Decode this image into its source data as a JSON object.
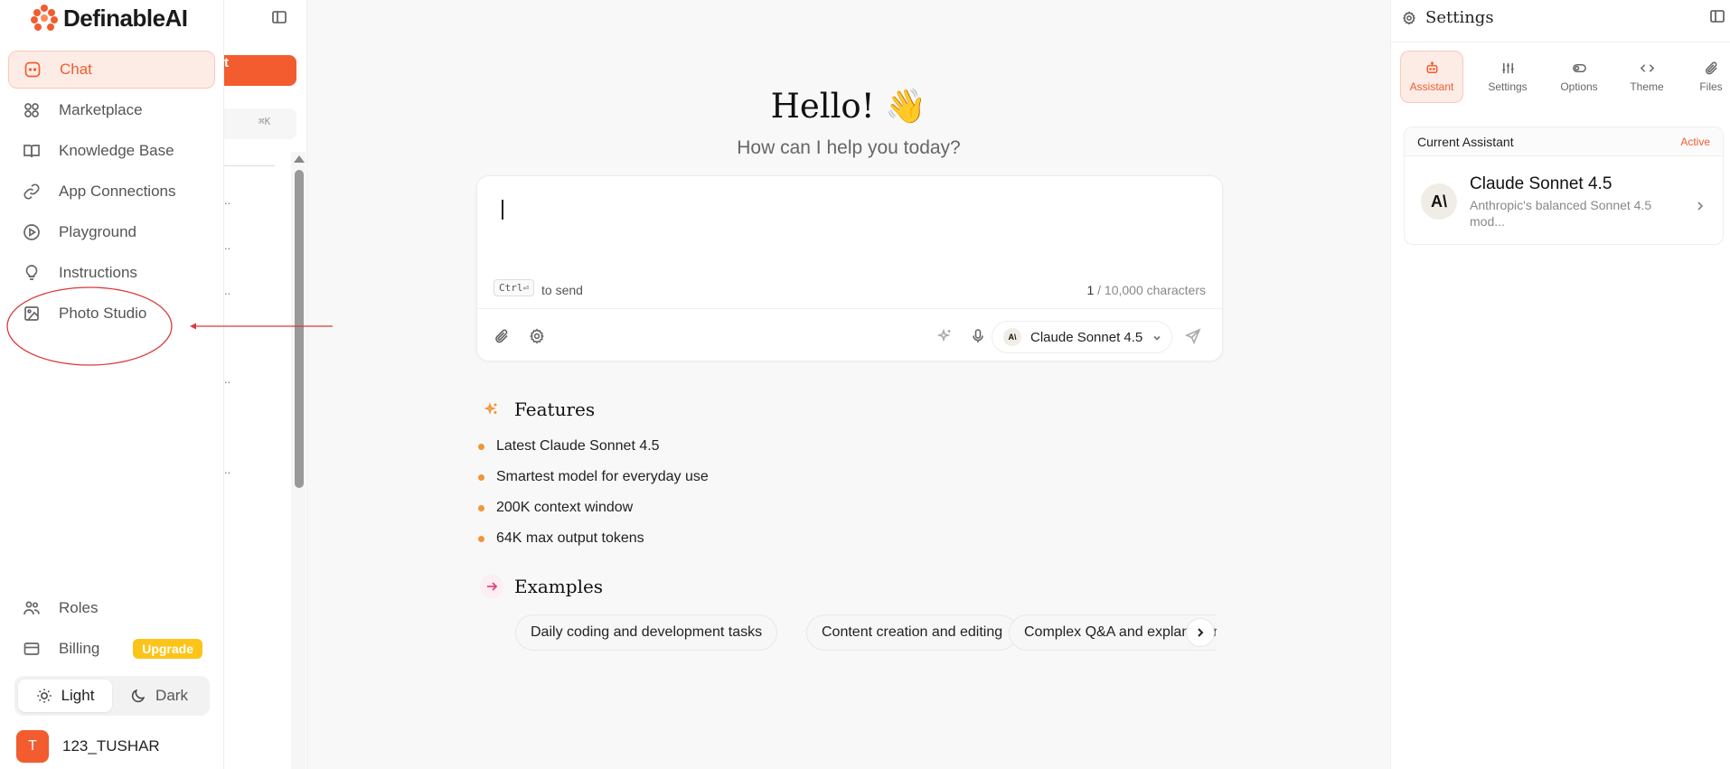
{
  "brand": {
    "name": "DefinableAI",
    "accent": "#f25c2f"
  },
  "nav": {
    "items": [
      {
        "label": "Chat",
        "icon": "chat-icon",
        "active": true
      },
      {
        "label": "Marketplace",
        "icon": "grid-icon"
      },
      {
        "label": "Knowledge Base",
        "icon": "book-icon"
      },
      {
        "label": "App Connections",
        "icon": "link-icon"
      },
      {
        "label": "Playground",
        "icon": "play-icon"
      },
      {
        "label": "Instructions",
        "icon": "lightbulb-icon"
      },
      {
        "label": "Photo Studio",
        "icon": "image-icon"
      }
    ],
    "bottom": [
      {
        "label": "Roles",
        "icon": "users-icon"
      },
      {
        "label": "Billing",
        "icon": "card-icon",
        "badge": "Upgrade"
      }
    ],
    "theme": {
      "light": "Light",
      "dark": "Dark",
      "selected": "Light"
    },
    "user": {
      "initial": "T",
      "name": "123_TUSHAR"
    }
  },
  "history": {
    "new_chat_label": "t",
    "search_shortcut": "⌘K",
    "truncated": [
      "..",
      "..",
      "..",
      "..",
      ".."
    ]
  },
  "main": {
    "greeting": "Hello! 👋",
    "subtitle": "How can I help you today?",
    "composer": {
      "shortcut_key": "Ctrl⏎",
      "send_hint": "to send",
      "char_count": "1",
      "char_limit": "/ 10,000 characters",
      "model": "Claude Sonnet 4.5",
      "model_badge": "A\\"
    },
    "features": {
      "title": "Features",
      "items": [
        "Latest Claude Sonnet 4.5",
        "Smartest model for everyday use",
        "200K context window",
        "64K max output tokens"
      ]
    },
    "examples": {
      "title": "Examples",
      "items": [
        "Daily coding and development tasks",
        "Content creation and editing",
        "Complex Q&A and explanations"
      ]
    }
  },
  "settings_panel": {
    "title": "Settings",
    "tabs": [
      {
        "label": "Assistant",
        "icon": "robot-icon",
        "active": true
      },
      {
        "label": "Settings",
        "icon": "sliders-icon"
      },
      {
        "label": "Options",
        "icon": "toggle-icon"
      },
      {
        "label": "Theme",
        "icon": "code-icon"
      },
      {
        "label": "Files",
        "icon": "paperclip-icon"
      }
    ],
    "current": {
      "heading": "Current Assistant",
      "status": "Active",
      "name": "Claude Sonnet 4.5",
      "description": "Anthropic's balanced Sonnet 4.5 mod...",
      "logo": "A\\"
    }
  },
  "annotation": {
    "color": "#d93a3a"
  }
}
